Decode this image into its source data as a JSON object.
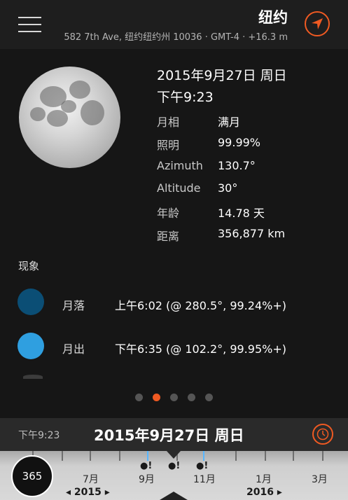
{
  "header": {
    "city": "纽约",
    "address": "582 7th Ave, 纽约纽约州 10036 · GMT-4 · +16.3 m"
  },
  "moon": {
    "date": "2015年9月27日 周日",
    "time": "下午9:23",
    "rows": [
      {
        "label": "月相",
        "value": "满月"
      },
      {
        "label": "照明",
        "value": "99.99%"
      },
      {
        "label": "Azimuth",
        "value": "130.7°"
      },
      {
        "label": "Altitude",
        "value": "30°"
      },
      {
        "label": "年龄",
        "value": "14.78 天"
      },
      {
        "label": "距离",
        "value": "356,877 km"
      }
    ]
  },
  "phenomena": {
    "title": "现象",
    "events": [
      {
        "name": "月落",
        "detail": "上午6:02 (@ 280.5°, 99.24%+)",
        "color": "#0b4e75"
      },
      {
        "name": "月出",
        "detail": "下午6:35 (@ 102.2°, 99.95%+)",
        "color": "#2f9fe0"
      }
    ]
  },
  "pager": {
    "count": 5,
    "active_index": 1,
    "accent": "#f05a22"
  },
  "bottom_bar": {
    "time": "下午9:23",
    "date": "2015年9月27日 周日"
  },
  "timeline": {
    "range_label": "365",
    "months": [
      "7月",
      "9月",
      "11月",
      "1月",
      "3月"
    ],
    "years": [
      "◂ 2015 ▸",
      "2016 ▸"
    ],
    "markers": [
      "●!",
      "●!",
      "●!"
    ]
  },
  "icons": {
    "menu": "hamburger-icon",
    "locate": "navigation-arrow-icon",
    "clock": "clock-icon"
  }
}
